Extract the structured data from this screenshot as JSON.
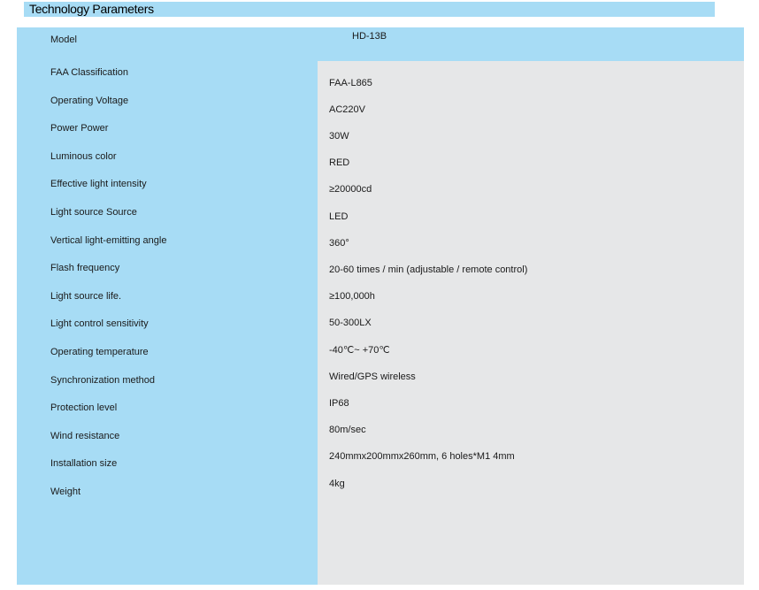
{
  "header": {
    "title": "Technology Parameters"
  },
  "table": {
    "model_label": "Model",
    "model_value": "HD-13B",
    "rows": [
      {
        "label": "FAA Classification",
        "value": "FAA-L865"
      },
      {
        "label": "Operating Voltage",
        "value": "AC220V"
      },
      {
        "label": "Power Power",
        "value": "30W"
      },
      {
        "label": "Luminous color",
        "value": "RED"
      },
      {
        "label": "Effective light intensity",
        "value": "≥20000cd"
      },
      {
        "label": "Light source Source",
        "value": "LED"
      },
      {
        "label": "Vertical light-emitting angle",
        "value": "360°"
      },
      {
        "label": "Flash frequency",
        "value": "20-60 times / min (adjustable / remote control)"
      },
      {
        "label": "Light source life.",
        "value": "≥100,000h"
      },
      {
        "label": "Light control sensitivity",
        "value": "50-300LX"
      },
      {
        "label": "Operating temperature",
        "value": "-40℃~ +70℃"
      },
      {
        "label": "Synchronization method",
        "value": "Wired/GPS wireless"
      },
      {
        "label": "Protection level",
        "value": "IP68"
      },
      {
        "label": "Wind resistance",
        "value": "80m/sec"
      },
      {
        "label": "Installation size",
        "value": "240mmx200mmx260mm, 6 holes*M1 4mm"
      },
      {
        "label": "Weight",
        "value": "4kg"
      }
    ]
  }
}
